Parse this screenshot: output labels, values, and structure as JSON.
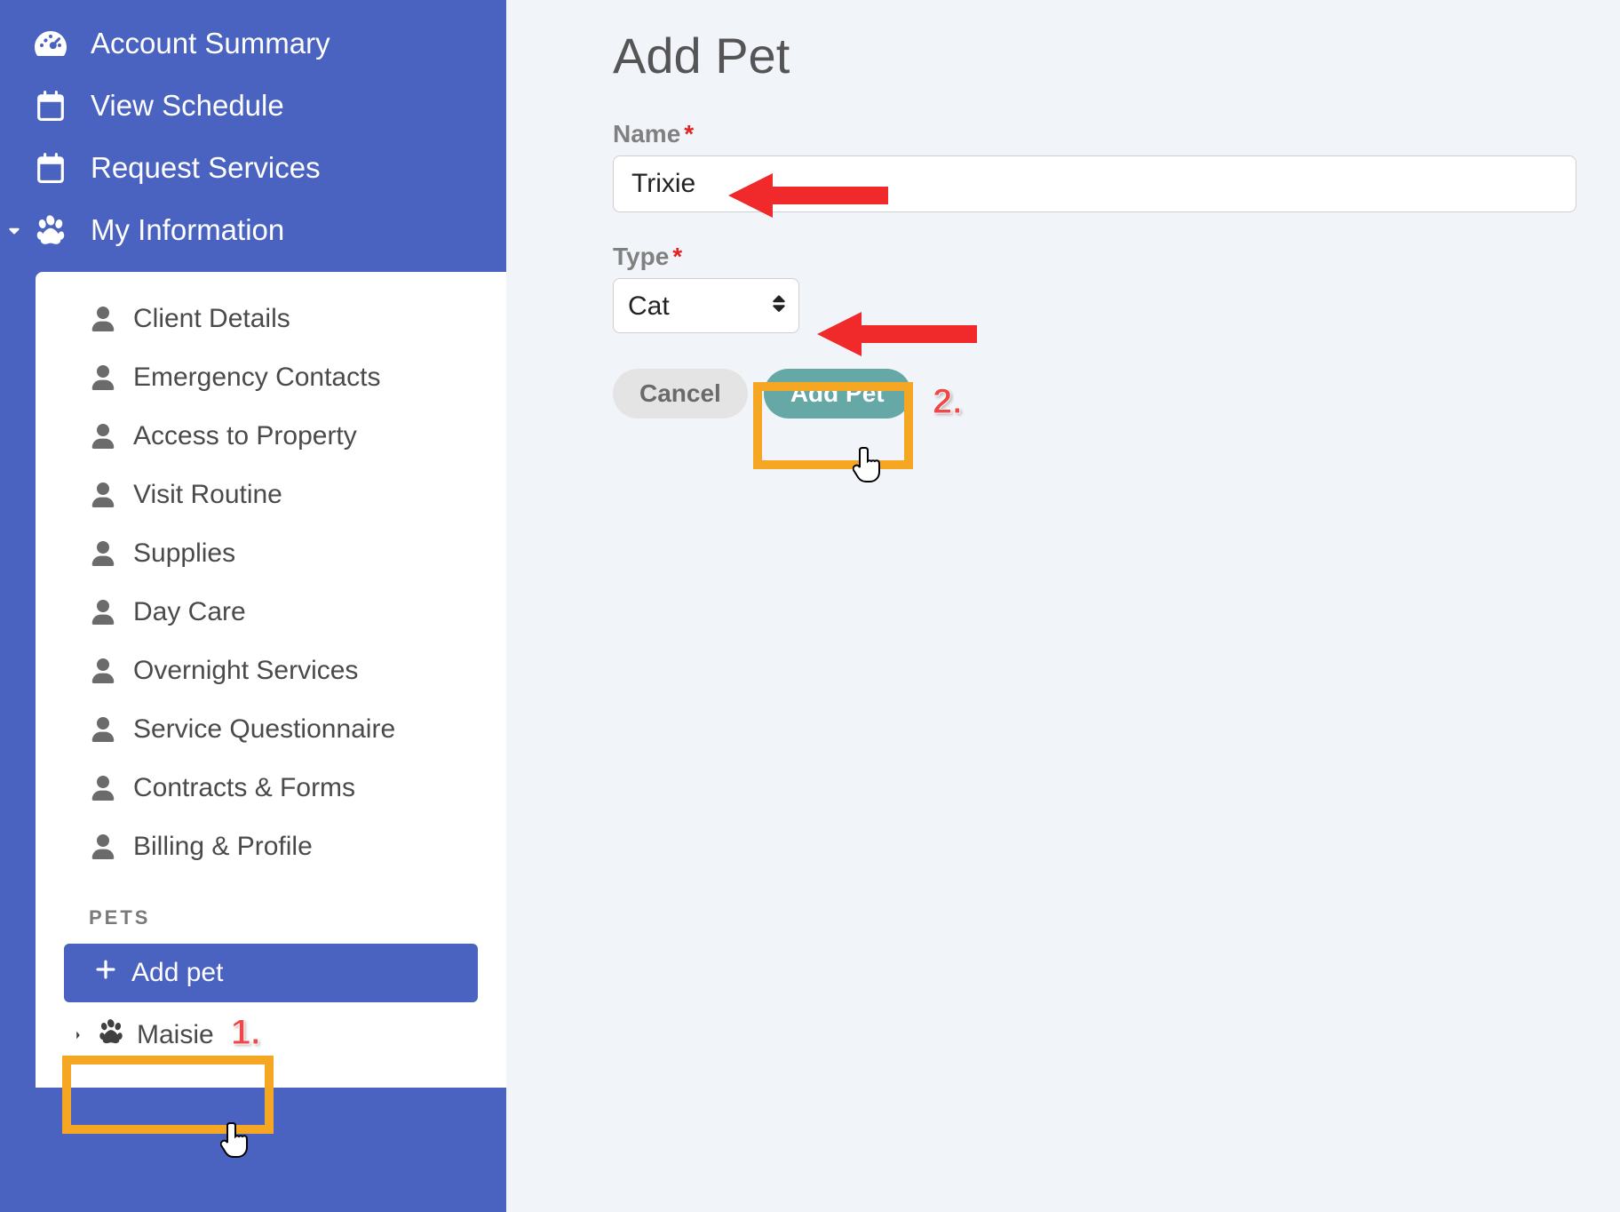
{
  "sidebar": {
    "nav": [
      {
        "label": "Account Summary"
      },
      {
        "label": "View Schedule"
      },
      {
        "label": "Request Services"
      },
      {
        "label": "My Information"
      }
    ],
    "sub_items": [
      "Client Details",
      "Emergency Contacts",
      "Access to Property",
      "Visit Routine",
      "Supplies",
      "Day Care",
      "Overnight Services",
      "Service Questionnaire",
      "Contracts & Forms",
      "Billing & Profile"
    ],
    "pets_header": "PETS",
    "add_pet_label": "Add pet",
    "pets": [
      {
        "name": "Maisie"
      }
    ]
  },
  "main": {
    "title": "Add Pet",
    "name_label": "Name",
    "name_value": "Trixie",
    "type_label": "Type",
    "type_value": "Cat",
    "cancel_label": "Cancel",
    "submit_label": "Add Pet"
  },
  "annotations": {
    "step1": "1.",
    "step2": "2."
  },
  "colors": {
    "sidebar_bg": "#4a62c0",
    "accent_teal": "#66a8a5",
    "highlight_orange": "#f5a623",
    "arrow_red": "#f02a2a"
  }
}
